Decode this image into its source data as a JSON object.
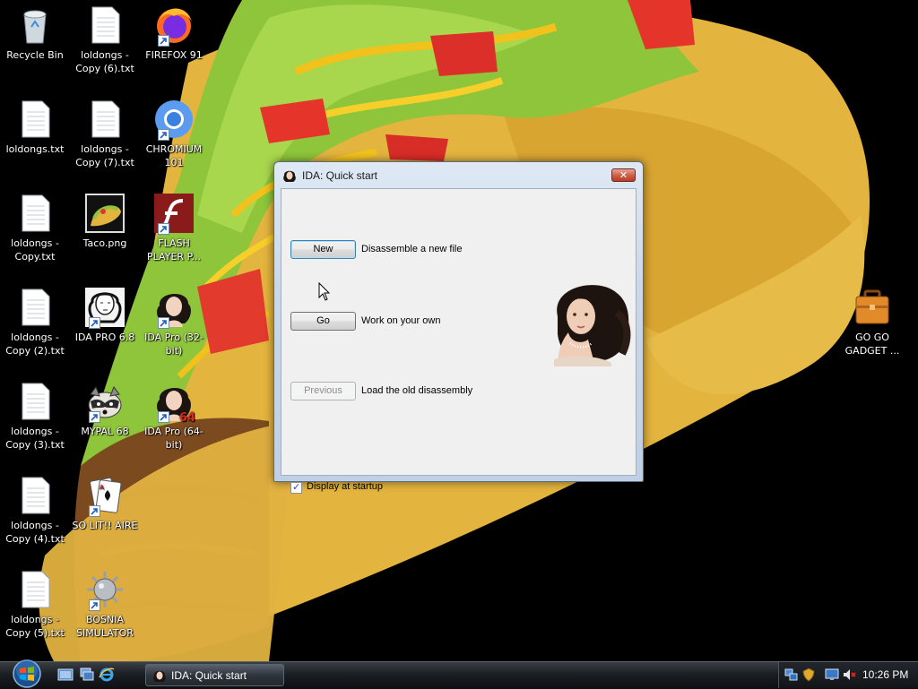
{
  "desktop": {
    "icons": [
      {
        "name": "recycle-bin",
        "label": "Recycle Bin"
      },
      {
        "name": "loldongs-copy-6",
        "label": "loldongs - Copy (6).txt"
      },
      {
        "name": "firefox-91",
        "label": "FIREFOX 91"
      },
      {
        "name": "loldongs",
        "label": "loldongs.txt"
      },
      {
        "name": "loldongs-copy-7",
        "label": "loldongs - Copy (7).txt"
      },
      {
        "name": "chromium-101",
        "label": "CHROMIUM 101"
      },
      {
        "name": "loldongs-copy",
        "label": "loldongs - Copy.txt"
      },
      {
        "name": "taco-png",
        "label": "Taco.png"
      },
      {
        "name": "flash-player",
        "label": "FLASH PLAYER P..."
      },
      {
        "name": "loldongs-copy-2",
        "label": "loldongs - Copy (2).txt"
      },
      {
        "name": "ida-pro-68",
        "label": "IDA PRO 6.8"
      },
      {
        "name": "ida-pro-32",
        "label": "IDA Pro (32-bit)"
      },
      {
        "name": "loldongs-copy-3",
        "label": "loldongs - Copy (3).txt"
      },
      {
        "name": "mypal-68",
        "label": "MYPAL 68"
      },
      {
        "name": "ida-pro-64",
        "label": "IDA Pro (64-bit)"
      },
      {
        "name": "loldongs-copy-4",
        "label": "loldongs - Copy (4).txt"
      },
      {
        "name": "so-lit-aire",
        "label": "SO LIT!! AIRE"
      },
      {
        "name": "loldongs-copy-5",
        "label": "loldongs - Copy (5).txt"
      },
      {
        "name": "bosnia-simulator",
        "label": "BOSNIA SIMULATOR"
      },
      {
        "name": "go-go-gadget",
        "label": "GO GO GADGET ..."
      }
    ]
  },
  "dialog": {
    "title": "IDA: Quick start",
    "close_label": "✕",
    "buttons": {
      "new": {
        "label": "New",
        "description": "Disassemble a new file"
      },
      "go": {
        "label": "Go",
        "description": "Work on your own"
      },
      "previous": {
        "label": "Previous",
        "description": "Load the old disassembly",
        "disabled": true
      }
    },
    "startup_checkbox": {
      "label": "Display at startup",
      "checked": true,
      "mark": "✓"
    }
  },
  "taskbar": {
    "window_button": "IDA: Quick start",
    "clock": "10:26 PM"
  },
  "colors": {
    "taskbar": "#1b1e22",
    "dialog_frame": "#c9d8ea",
    "dialog_body": "#f0f0f0",
    "close_button": "#d0624a"
  }
}
